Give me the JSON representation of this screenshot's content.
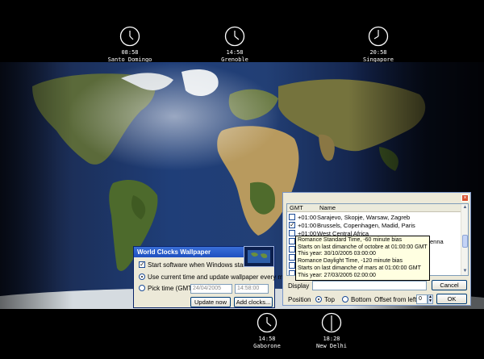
{
  "clocks_top": [
    {
      "time": "08:58",
      "city": "Santo Domingo"
    },
    {
      "time": "14:58",
      "city": "Grenoble"
    },
    {
      "time": "20:58",
      "city": "Singapore"
    }
  ],
  "clocks_bottom": [
    {
      "time": "14:58",
      "city": "Gaborone"
    },
    {
      "time": "18:28",
      "city": "New Delhi"
    }
  ],
  "wallpaper_window": {
    "title": "World Clocks Wallpaper",
    "help_glyph": "?",
    "close_glyph": "×",
    "start_label": "Start software when Windows starts",
    "use_current_label": "Use current time and update wallpaper every minute",
    "pick_time_label": "Pick time (GMT):",
    "date_value": "24/04/2005",
    "time_value": "14:58:00",
    "update_button": "Update now",
    "add_button": "Add clocks..."
  },
  "add_dialog": {
    "col_gmt": "GMT",
    "col_name": "Name",
    "rows": [
      {
        "gmt": "+01:00",
        "name": "Sarajevo, Skopje, Warsaw, Zagreb",
        "checked": false
      },
      {
        "gmt": "+01:00",
        "name": "Brussels, Copenhagen, Madid, Paris",
        "checked": true
      },
      {
        "gmt": "+01:00",
        "name": "West Central Africa",
        "checked": false
      },
      {
        "gmt": "+0",
        "name": "enna",
        "checked": false
      },
      {
        "gmt": "+0",
        "name": "",
        "checked": false
      },
      {
        "gmt": "+0",
        "name": "",
        "checked": false
      },
      {
        "gmt": "+0",
        "name": "",
        "checked": false
      },
      {
        "gmt": "+0",
        "name": "",
        "checked": false
      }
    ],
    "tooltip_lines": [
      "Romance Standard Time, -60 minute bias",
      "Starts on last dimanche of octobre at 01:00:00 GMT",
      "This year: 30/10/2005 03:00:00",
      "Romance Daylight Time, -120 minute bias",
      "Starts on last dimanche of mars at 01:00:00 GMT",
      "This year: 27/03/2005 02:00:00"
    ],
    "display_label": "Display",
    "cancel_button": "Cancel",
    "position_label": "Position",
    "top_label": "Top",
    "bottom_label": "Bottom",
    "offset_label": "Offset from left",
    "offset_value": "0",
    "ok_button": "OK",
    "close_glyph": "×"
  }
}
